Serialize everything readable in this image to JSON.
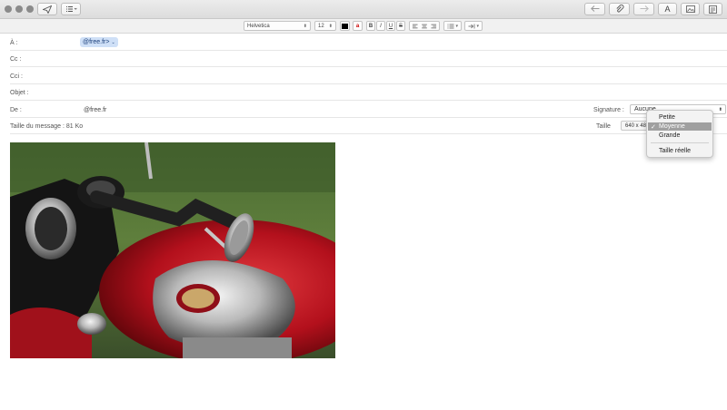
{
  "toolbar": {
    "left_buttons": [
      {
        "name": "send-button",
        "icon": "paper-plane-icon"
      },
      {
        "name": "header-fields-button",
        "icon": "list-icon"
      }
    ],
    "right_buttons": [
      {
        "name": "reply-button",
        "icon": "reply-arrow-icon"
      },
      {
        "name": "attach-button",
        "icon": "paperclip-icon"
      },
      {
        "name": "forward-button",
        "icon": "forward-arrow-icon"
      },
      {
        "name": "format-button",
        "icon": "A"
      },
      {
        "name": "photo-browser-button",
        "icon": "photo-icon"
      },
      {
        "name": "stationery-button",
        "icon": "stationery-icon"
      }
    ],
    "format_label": "A"
  },
  "format_bar": {
    "font": "Helvetica",
    "size": "12",
    "bold": "B",
    "italic": "I",
    "underline": "U",
    "strikethrough": "S"
  },
  "header": {
    "to_label": "À :",
    "to_recipient": "@free.fr>",
    "cc_label": "Cc :",
    "bcc_label": "Cci :",
    "subject_label": "Objet :",
    "from_label": "De :",
    "from_value": "@free.fr",
    "signature_label": "Signature :",
    "signature_value": "Aucune",
    "message_size": "Taille du message : 81 Ko",
    "image_size_label": "Taille",
    "image_dimensions": "640 x 480"
  },
  "image_size_menu": {
    "options": [
      "Petite",
      "Moyenne",
      "Grande",
      "Taille réelle"
    ],
    "selected": "Moyenne"
  },
  "colors": {
    "token_bg": "#cfe0f7",
    "menu_selected": "#a0a0a0",
    "tank_red": "#b3101c"
  }
}
